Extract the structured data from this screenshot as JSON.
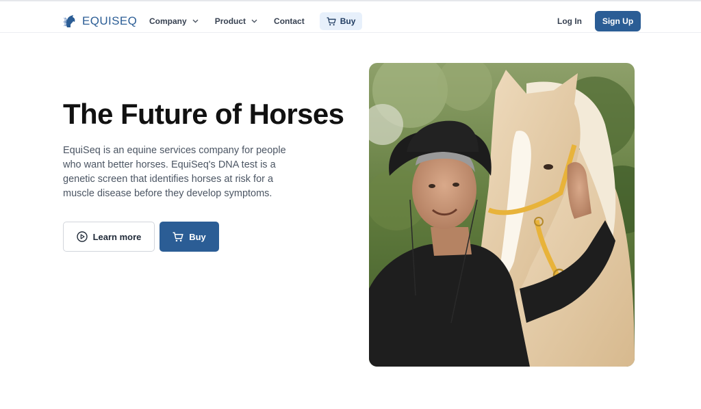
{
  "brand": {
    "name": "EQUISEQ",
    "accent": "#2b5d95"
  },
  "nav": {
    "company_label": "Company",
    "product_label": "Product",
    "contact_label": "Contact",
    "buy_label": "Buy",
    "login_label": "Log In",
    "signup_label": "Sign Up"
  },
  "hero": {
    "title": "The Future of Horses",
    "description": "EquiSeq is an equine services company for people who want better horses. EquiSeq's DNA test is a genetic screen that identifies horses at risk for a muscle disease before they develop symptoms.",
    "learn_more_label": "Learn more",
    "buy_label": "Buy"
  },
  "icons": {
    "logo": "horse-dna-logo-icon",
    "dropdown": "chevron-down-icon",
    "cart": "cart-icon",
    "play": "play-circle-icon"
  },
  "colors": {
    "primary": "#2b5d95",
    "nav_buy_bg": "#e7f0fb",
    "text_dark": "#111111",
    "text_body": "#4b5563"
  }
}
